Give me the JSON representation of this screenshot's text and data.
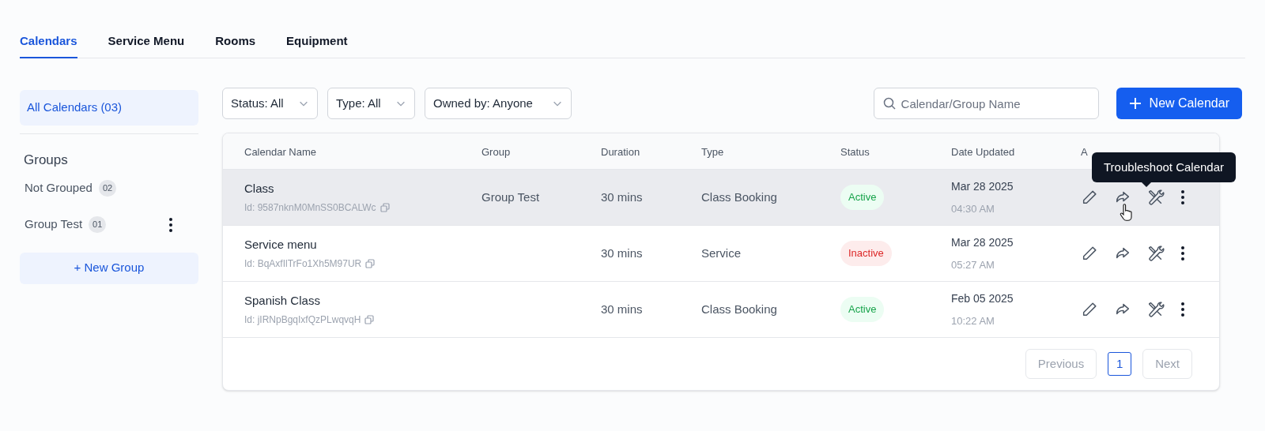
{
  "tabs": [
    {
      "label": "Calendars",
      "selected": true
    },
    {
      "label": "Service Menu",
      "selected": false
    },
    {
      "label": "Rooms",
      "selected": false
    },
    {
      "label": "Equipment",
      "selected": false
    }
  ],
  "sidebar": {
    "all_item": {
      "label": "All Calendars (03)",
      "selected": true
    },
    "groups_title": "Groups",
    "groups": [
      {
        "label": "Not Grouped",
        "count": "02",
        "has_menu": false
      },
      {
        "label": "Group Test",
        "count": "01",
        "has_menu": true
      }
    ],
    "new_group_button": "+ New Group"
  },
  "filters": [
    "Status: All",
    "Type: All",
    "Owned by: Anyone"
  ],
  "search": {
    "placeholder": "Calendar/Group Name"
  },
  "new_calendar_button": "New Calendar",
  "table": {
    "columns": [
      "Calendar Name",
      "Group",
      "Duration",
      "Type",
      "Status",
      "Date Updated",
      "A"
    ],
    "rows": [
      {
        "name": "Class",
        "id": "Id: 9587nknM0MnSS0BCALWc",
        "group": "Group Test",
        "duration": "30 mins",
        "type": "Class Booking",
        "status": "Active",
        "kind": "active",
        "date": "Mar 28 2025",
        "time": "04:30 AM",
        "selected": true
      },
      {
        "name": "Service menu",
        "id": "Id: BqAxfIlTrFo1Xh5M97UR",
        "duration": "30 mins",
        "type": "Service",
        "status": "Inactive",
        "kind": "inactive",
        "date": "Mar 28 2025",
        "time": "05:27 AM",
        "selected": false
      },
      {
        "name": "Spanish Class",
        "id": "Id: jIRNpBgqIxfQzPLwqvqH",
        "duration": "30 mins",
        "type": "Class Booking",
        "status": "Active",
        "kind": "active",
        "date": "Feb 05 2025",
        "time": "10:22 AM",
        "selected": false
      }
    ]
  },
  "tooltip": "Troubleshoot Calendar",
  "pagination": {
    "previous": "Previous",
    "pages": [
      {
        "label": "1",
        "selected": true
      }
    ],
    "next": "Next"
  }
}
